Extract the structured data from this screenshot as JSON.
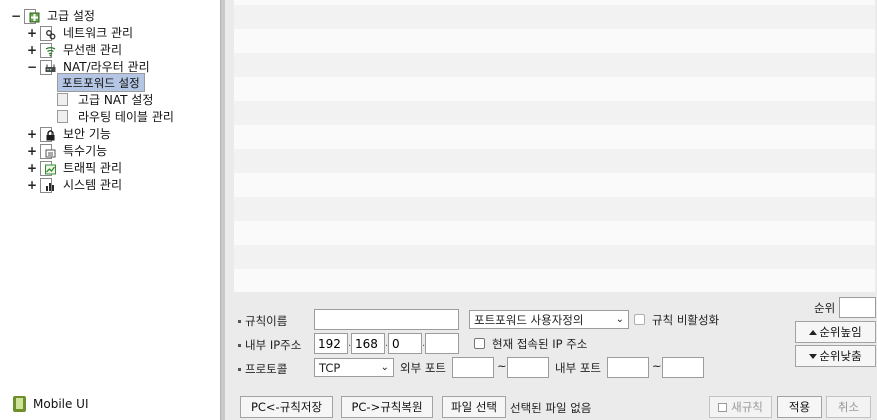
{
  "tree": {
    "root": {
      "toggle": "−",
      "label": "고급 설정",
      "icon": "settings-folder-icon"
    },
    "items": [
      {
        "toggle": "+",
        "label": "네트워크 관리",
        "icon": "network-icon",
        "icon_color": "#3b3b3b"
      },
      {
        "toggle": "+",
        "label": "무선랜 관리",
        "icon": "wireless-icon",
        "icon_color": "#2f7a2f"
      },
      {
        "toggle": "−",
        "label": "NAT/라우터 관리",
        "icon": "router-icon",
        "icon_color": "#4a4a4a"
      },
      {
        "label": "포트포워드 설정",
        "selected": true
      },
      {
        "label": "고급 NAT 설정"
      },
      {
        "label": "라우팅 테이블 관리"
      },
      {
        "toggle": "+",
        "label": "보안 기능",
        "icon": "lock-icon",
        "icon_color": "#1d1d1d"
      },
      {
        "toggle": "+",
        "label": "특수기능",
        "icon": "special-icon",
        "icon_color": "#555555"
      },
      {
        "toggle": "+",
        "label": "트래픽 관리",
        "icon": "traffic-icon",
        "icon_color": "#3a8a3a"
      },
      {
        "toggle": "+",
        "label": "시스템 관리",
        "icon": "system-icon",
        "icon_color": "#2a2a2a"
      }
    ],
    "mobile_ui": "Mobile UI"
  },
  "form": {
    "rule_name_label": "규칙이름",
    "rule_name_value": "",
    "rule_type_selected": "포트포워드 사용자정의",
    "disable_rule_label": "규칙 비활성화",
    "internal_ip_label": "내부 IP주소",
    "ip": [
      "192",
      "168",
      "0",
      ""
    ],
    "current_ip_label": "현재 접속된 IP 주소",
    "protocol_label": "프로토콜",
    "protocol_selected": "TCP",
    "external_port_label": "외부 포트",
    "internal_port_label": "내부 포트",
    "range_sep": "~",
    "priority_label": "순위",
    "priority_value": "",
    "priority_up": "순위높임",
    "priority_down": "순위낮춤"
  },
  "footer": {
    "save_to_pc": "PC<-규칙저장",
    "restore_from_pc": "PC->규칙복원",
    "choose_file": "파일 선택",
    "no_file": "선택된 파일 없음",
    "new_rule": "새규칙",
    "apply": "적용",
    "cancel": "취소"
  },
  "colors": {
    "selected_bg": "#b4c6e3",
    "panel_bg": "#ebebeb"
  }
}
